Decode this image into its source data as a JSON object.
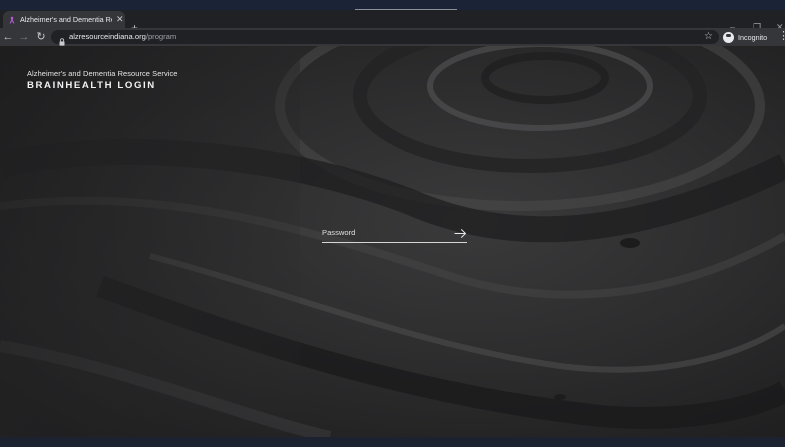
{
  "browser": {
    "tab": {
      "title": "Alzheimer's and Dementia Resou",
      "favicon": "purple-ribbon-icon",
      "close_icon": "close-icon"
    },
    "new_tab_icon": "plus-icon",
    "window_controls": {
      "tab_search": "chevron-down-icon",
      "minimize": "minimize-icon",
      "restore": "restore-icon",
      "close": "close-icon"
    },
    "nav": {
      "back": "back-arrow-icon",
      "forward": "forward-arrow-icon",
      "reload": "reload-icon"
    },
    "address": {
      "lock_icon": "lock-icon",
      "domain": "alzresourceindiana.org",
      "path": "/program"
    },
    "bookmark_icon": "star-icon",
    "profile": {
      "label": "Incognito",
      "icon": "incognito-icon"
    },
    "menu_icon": "kebab-menu-icon"
  },
  "page": {
    "brand_subtitle": "Alzheimer's and Dementia Resource Service",
    "brand_title": "BRAINHEALTH LOGIN",
    "password": {
      "placeholder": "Password",
      "value": "",
      "submit_icon": "arrow-right-icon"
    }
  },
  "colors": {
    "accent_favicon": "#b25bd6",
    "page_background": "#2a2a2b"
  }
}
